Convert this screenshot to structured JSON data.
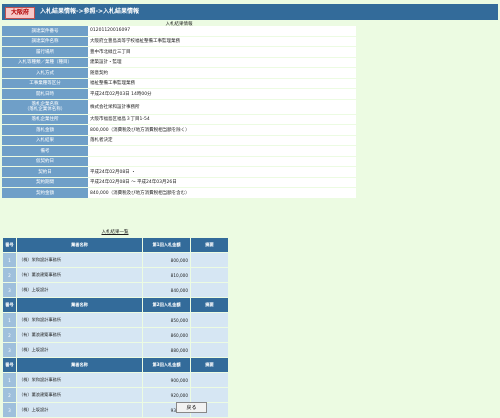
{
  "header": {
    "prefecture": "大阪府",
    "breadcrumb": "入札結果情報->参照->入札結果情報"
  },
  "info_section": {
    "title": "入札結果情報",
    "rows": [
      {
        "label": "調達案件番号",
        "value": "01201120016097"
      },
      {
        "label": "調達案件名称",
        "value": "大阪府立豊島高等学校福祉整備工事監理業務"
      },
      {
        "label": "履行場所",
        "value": "豊中市北緑丘三丁目"
      },
      {
        "label": "入札等種類／業種（種目）",
        "value": "建築設計・監理"
      },
      {
        "label": "入札方式",
        "value": "随意契約"
      },
      {
        "label": "工事業種等区分",
        "value": "福祉整備工事監理業務"
      },
      {
        "label": "開札日時",
        "value": "平成24年02月03日 14時00分"
      },
      {
        "label": "落札企業名称",
        "label2": "（落札企業体名称）",
        "value": "株式会社栄和設計事務所"
      },
      {
        "label": "落札企業住所",
        "value": "大阪市福島区福島３丁目1-54"
      },
      {
        "label": "落札金額",
        "value": "800,000（消費税及び地方消費税相当額を除く）"
      },
      {
        "label": "入札結果",
        "value": "落札者決定"
      },
      {
        "label": "備考",
        "value": ""
      },
      {
        "label": "仮契約日",
        "value": ""
      },
      {
        "label": "契約日",
        "value": "平成24年02月08日 ・"
      },
      {
        "label": "契約期間",
        "value": "平成24年02月08日 ～ 平成24年03月26日"
      },
      {
        "label": "契約金額",
        "value": "840,000（消費税及び地方消費税相当額を含む）"
      }
    ]
  },
  "bids_section": {
    "title": "入札結果一覧",
    "rounds": [
      {
        "headers": [
          "番号",
          "業者名称",
          "第1回入札金額",
          "摘要"
        ],
        "rows": [
          {
            "no": "1",
            "name": "（株）栄和設計事務所",
            "amount": "800,000",
            "note": ""
          },
          {
            "no": "2",
            "name": "（有）薫浪建築事務所",
            "amount": "810,000",
            "note": ""
          },
          {
            "no": "3",
            "name": "（株）上坂設計",
            "amount": "840,000",
            "note": ""
          }
        ]
      },
      {
        "headers": [
          "番号",
          "業者名称",
          "第2回入札金額",
          "摘要"
        ],
        "rows": [
          {
            "no": "1",
            "name": "（株）栄和設計事務所",
            "amount": "850,000",
            "note": ""
          },
          {
            "no": "2",
            "name": "（有）薫浪建築事務所",
            "amount": "860,000",
            "note": ""
          },
          {
            "no": "3",
            "name": "（株）上坂設計",
            "amount": "880,000",
            "note": ""
          }
        ]
      },
      {
        "headers": [
          "番号",
          "業者名称",
          "第3回入札金額",
          "摘要"
        ],
        "rows": [
          {
            "no": "1",
            "name": "（株）栄和設計事務所",
            "amount": "900,000",
            "note": ""
          },
          {
            "no": "2",
            "name": "（有）薫浪建築事務所",
            "amount": "920,000",
            "note": ""
          },
          {
            "no": "3",
            "name": "（株）上坂設計",
            "amount": "930,000",
            "note": ""
          }
        ]
      }
    ]
  },
  "back_button": "戻る"
}
